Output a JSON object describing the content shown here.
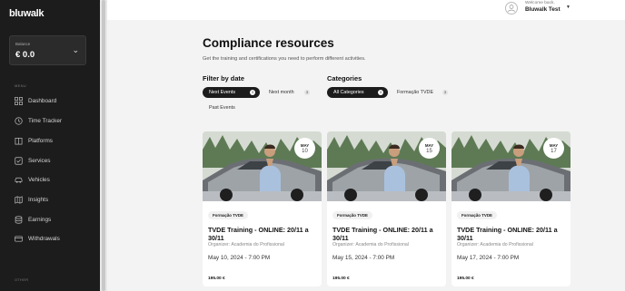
{
  "brand": {
    "logo": "bluwalk"
  },
  "balance": {
    "label": "Balance",
    "value": "€ 0.0"
  },
  "sidebar": {
    "menu_label": "MENU",
    "other_label": "OTHER",
    "items": [
      {
        "label": "Dashboard",
        "icon": "grid-icon"
      },
      {
        "label": "Time Tracker",
        "icon": "clock-icon"
      },
      {
        "label": "Platforms",
        "icon": "building-icon"
      },
      {
        "label": "Services",
        "icon": "check-square-icon"
      },
      {
        "label": "Vehicles",
        "icon": "car-icon"
      },
      {
        "label": "Insights",
        "icon": "map-icon"
      },
      {
        "label": "Earnings",
        "icon": "database-icon"
      },
      {
        "label": "Withdrawals",
        "icon": "card-icon"
      }
    ]
  },
  "user": {
    "welcome": "Welcome back,",
    "name": "Bluwalk Test"
  },
  "page": {
    "title": "Compliance resources",
    "subtitle": "Get the training and certifications you need to perform different activities."
  },
  "filters": {
    "date_heading": "Filter by date",
    "date_options": [
      {
        "label": "Next Events",
        "count": "3",
        "active": true
      },
      {
        "label": "Next month",
        "count": "3",
        "active": false
      },
      {
        "label": "Past Events",
        "count": "",
        "active": false
      }
    ],
    "categories_heading": "Categories",
    "category_options": [
      {
        "label": "All Categories",
        "count": "3",
        "active": true
      },
      {
        "label": "Formação TVDE",
        "count": "3",
        "active": false
      }
    ]
  },
  "events": [
    {
      "month": "MAY",
      "day": "10",
      "tag": "Formação TVDE",
      "title": "TVDE Training - ONLINE: 20/11 a 30/11",
      "organizer": "Organizer: Academia do Profissional",
      "date": "May 10, 2024 - 7:00 PM",
      "price": "195.00 €"
    },
    {
      "month": "MAY",
      "day": "15",
      "tag": "Formação TVDE",
      "title": "TVDE Training - ONLINE: 20/11 a 30/11",
      "organizer": "Organizer: Academia do Profissional",
      "date": "May 15, 2024 - 7:00 PM",
      "price": "195.00 €"
    },
    {
      "month": "MAY",
      "day": "17",
      "tag": "Formação TVDE",
      "title": "TVDE Training - ONLINE: 20/11 a 30/11",
      "organizer": "Organizer: Academia do Profissional",
      "date": "May 17, 2024 - 7:00 PM",
      "price": "195.00 €"
    }
  ]
}
